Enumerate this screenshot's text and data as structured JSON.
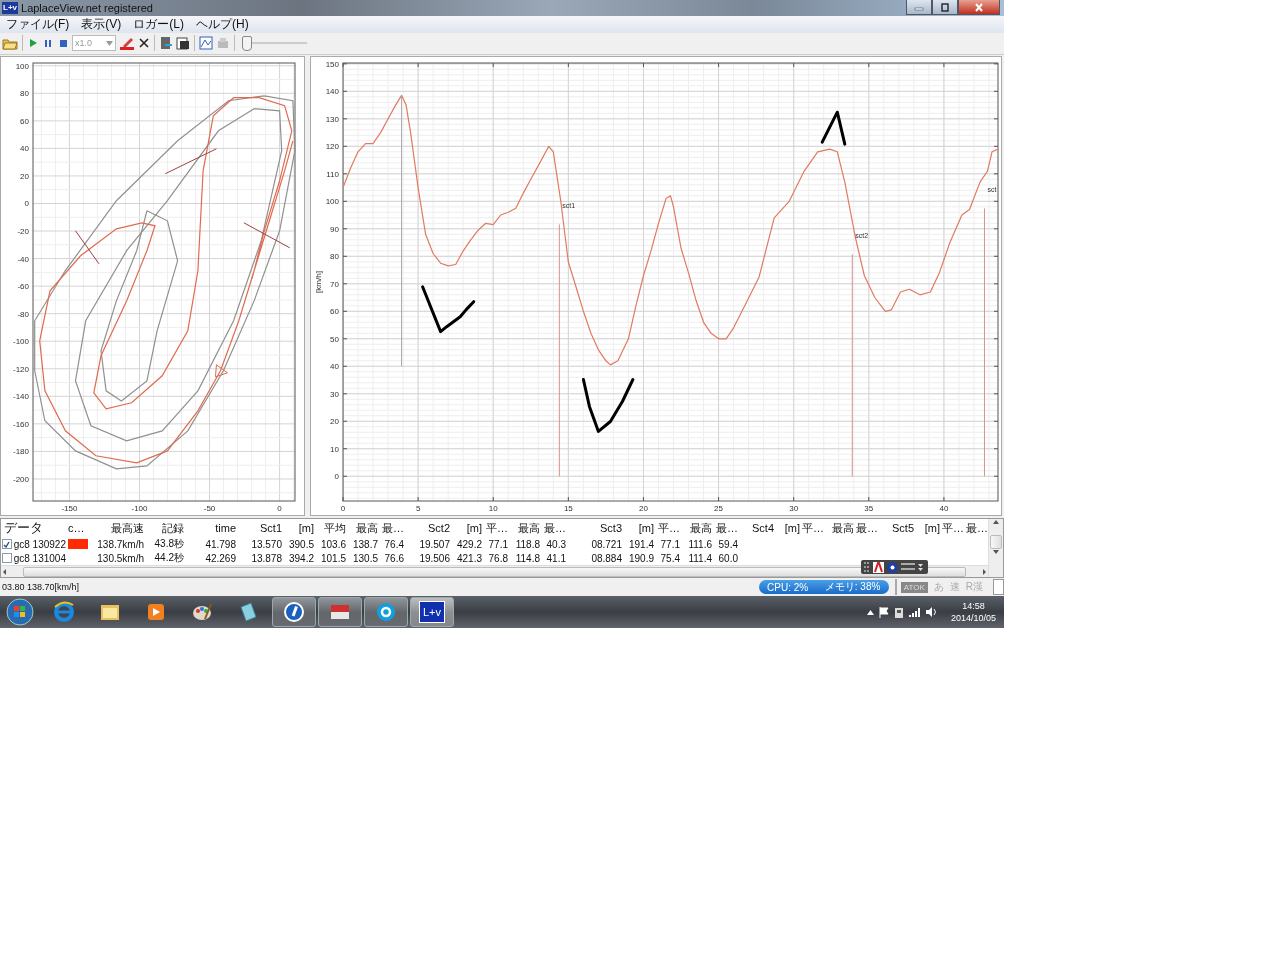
{
  "window": {
    "title": "LaplaceView.net registered",
    "app_icon": "L+v"
  },
  "menu": [
    "ファイル(F)",
    "表示(V)",
    "ロガー(L)",
    "ヘルプ(H)"
  ],
  "toolbar": {
    "speed": "x1.0",
    "playback_slider": {
      "level": 0
    }
  },
  "track_map": {
    "x_tick_labels": [
      "-150",
      "-100",
      "-50",
      "0"
    ],
    "y_tick_labels": [
      "100",
      "80",
      "60",
      "40",
      "20",
      "0",
      "-20",
      "-40",
      "-60",
      "-80",
      "-100",
      "-120",
      "-140",
      "-160",
      "-180",
      "-200"
    ]
  },
  "speed_chart": {
    "chart_data": {
      "type": "line",
      "ylabel": "[km/h]",
      "grid": true,
      "xlim": [
        0,
        43.6
      ],
      "ylim": [
        -9,
        150.3
      ],
      "xticks": [
        0,
        5,
        10,
        15,
        20,
        25,
        30,
        35,
        40
      ],
      "yticks": [
        0,
        10,
        20,
        30,
        40,
        50,
        60,
        70,
        80,
        90,
        100,
        110,
        120,
        130,
        140,
        150
      ],
      "x": [
        0,
        0.5,
        1,
        1.5,
        2,
        2.5,
        3,
        3.5,
        3.9,
        4.2,
        4.5,
        5,
        5.5,
        6,
        6.5,
        7,
        7.5,
        8,
        8.5,
        9,
        9.5,
        10,
        10.5,
        11,
        11.5,
        12,
        12.5,
        13,
        13.7,
        14,
        14.5,
        15,
        15.5,
        16,
        16.5,
        17,
        17.5,
        17.8,
        18.3,
        19,
        19.5,
        20,
        20.5,
        21,
        21.5,
        21.8,
        22,
        22.5,
        23,
        23.5,
        24,
        24.5,
        25,
        25.5,
        26,
        26.7,
        27.7,
        28.7,
        29.7,
        30.7,
        31.6,
        32.4,
        32.9,
        33.4,
        34.1,
        34.7,
        35.4,
        36.1,
        36.5,
        37.1,
        37.7,
        38.4,
        39.1,
        39.7,
        40.4,
        41.2,
        41.7,
        42.4,
        42.9,
        43.2,
        43.6
      ],
      "series": [
        {
          "color": "#e07a60",
          "values": [
            105,
            112,
            118,
            121,
            121,
            125,
            130,
            135,
            138.5,
            135,
            125,
            105,
            88,
            81,
            77.5,
            76.5,
            77,
            82,
            86,
            89.5,
            92,
            91.5,
            95,
            96,
            97.5,
            103,
            108,
            113,
            120,
            118,
            100,
            78,
            69,
            60,
            52,
            46,
            42,
            40.5,
            42,
            50,
            62,
            73,
            82,
            92,
            101,
            102,
            98,
            83,
            74,
            64,
            56,
            52,
            50,
            50,
            54,
            61.6,
            72.5,
            94,
            100,
            111,
            118,
            119,
            118,
            107,
            87,
            73,
            65,
            60,
            60.5,
            67,
            68,
            66,
            67,
            74,
            85,
            95,
            97,
            107,
            111,
            118,
            119
          ]
        }
      ],
      "ref_lines": [
        {
          "axis": "x",
          "value": 3.9,
          "color": "#a8a8a8"
        },
        {
          "axis": "x",
          "value": 14.4,
          "label": "sct1",
          "color": "#d89090"
        },
        {
          "axis": "x",
          "value": 33.9,
          "label": "sct2",
          "color": "#d89090"
        },
        {
          "axis": "x",
          "value": 42.7,
          "label": "sct",
          "color": "#d89090"
        }
      ]
    }
  },
  "laps_table": {
    "columns": [
      "データ",
      "c…",
      "最高速",
      "記録",
      "time",
      "Sct1",
      "[m]",
      "平均",
      "最高",
      "最…",
      "Sct2",
      "[m]",
      "平…",
      "最高",
      "最…",
      "Sct3",
      "[m]",
      "平…",
      "最高",
      "最…",
      "Sct4",
      "[m]",
      "平…",
      "最高",
      "最…",
      "Sct5",
      "[m]",
      "平…",
      "最…"
    ],
    "rows": [
      {
        "checked": true,
        "color": "#ff2a00",
        "cells": [
          "gc8 130922",
          "",
          "138.7km/h",
          "43.8秒",
          "41.798",
          "13.570",
          "390.5",
          "103.6",
          "138.7",
          "76.4",
          "19.507",
          "429.2",
          "77.1",
          "118.8",
          "40.3",
          "08.721",
          "191.4",
          "77.1",
          "111.6",
          "59.4"
        ]
      },
      {
        "checked": false,
        "cells": [
          "gc8 131004",
          "",
          "130.5km/h",
          "44.2秒",
          "42.269",
          "13.878",
          "394.2",
          "101.5",
          "130.5",
          "76.6",
          "19.506",
          "421.3",
          "76.8",
          "114.8",
          "41.1",
          "08.884",
          "190.9",
          "75.4",
          "111.4",
          "60.0"
        ]
      }
    ]
  },
  "status_bar": {
    "reading": "03.80 138.70[km/h]",
    "cpu": "CPU: 2%",
    "memory": "メモリ: 38%",
    "ime": [
      "ATOK",
      "あ",
      "速",
      "R漢"
    ]
  },
  "taskbar": {
    "apps": [
      {
        "kind": "browser",
        "running": false,
        "active": false
      },
      {
        "kind": "folder",
        "running": false,
        "active": false
      },
      {
        "kind": "media",
        "running": false,
        "active": false
      },
      {
        "kind": "paint",
        "running": false,
        "active": false
      },
      {
        "kind": "notes",
        "running": false,
        "active": false
      },
      {
        "kind": "blue_circle",
        "running": true,
        "active": false
      },
      {
        "kind": "red_app",
        "running": true,
        "active": false
      },
      {
        "kind": "skype",
        "running": true,
        "active": false
      },
      {
        "kind": "laplace",
        "label": "L+v",
        "running": true,
        "active": true
      }
    ],
    "time": "14:58",
    "date": "2014/10/05"
  }
}
